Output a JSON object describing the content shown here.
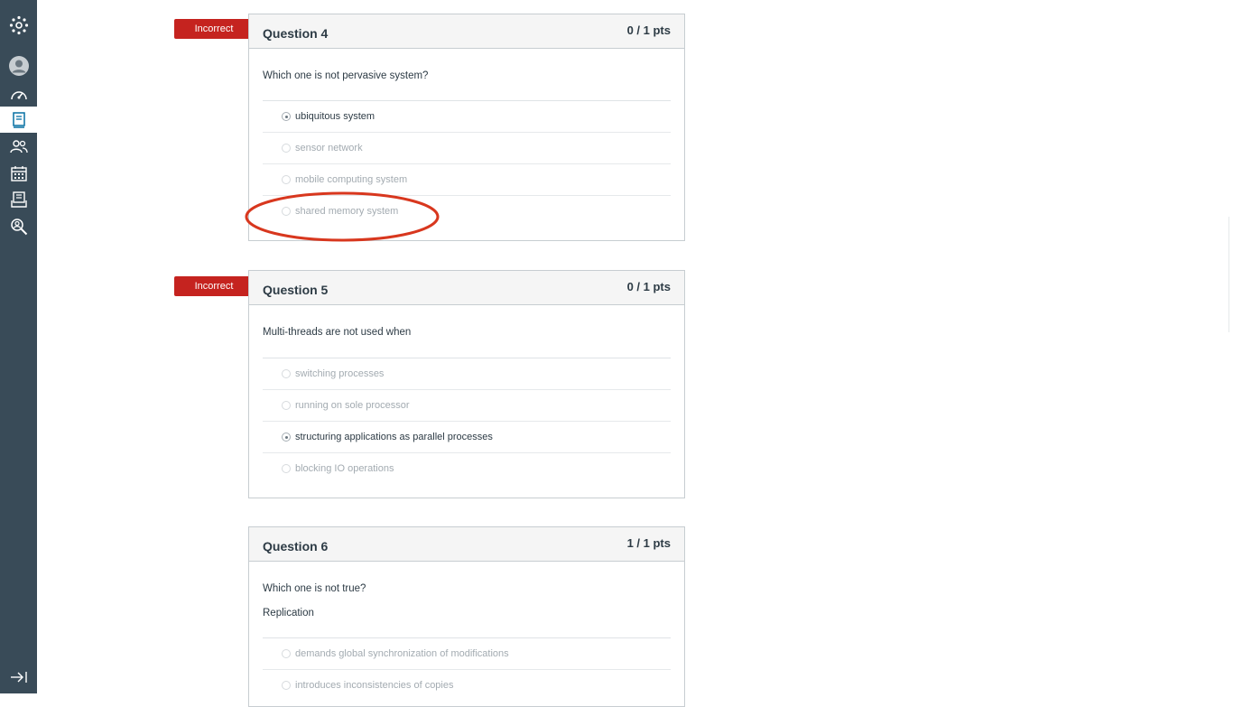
{
  "nav": {
    "items": [
      {
        "name": "logo",
        "icon": "canvas-logo-icon"
      },
      {
        "name": "account",
        "icon": "account-icon"
      },
      {
        "name": "dashboard",
        "icon": "dashboard-icon"
      },
      {
        "name": "courses",
        "icon": "courses-icon",
        "active": true
      },
      {
        "name": "groups",
        "icon": "groups-icon"
      },
      {
        "name": "calendar",
        "icon": "calendar-icon"
      },
      {
        "name": "inbox",
        "icon": "inbox-icon"
      },
      {
        "name": "help",
        "icon": "help-icon"
      },
      {
        "name": "collapse",
        "icon": "collapse-nav-icon"
      }
    ]
  },
  "colors": {
    "nav_bg": "#394b58",
    "accent": "#0770a3",
    "incorrect_red": "#c5231f",
    "annotation_red": "#d8371e"
  },
  "questions": [
    {
      "status": "Incorrect",
      "title": "Question 4",
      "points": "0 / 1 pts",
      "text": [
        "Which one is not pervasive system?"
      ],
      "answers": [
        {
          "label": "ubiquitous system",
          "selected": true
        },
        {
          "label": "sensor network",
          "selected": false
        },
        {
          "label": "mobile computing system",
          "selected": false
        },
        {
          "label": "shared memory system",
          "selected": false
        }
      ]
    },
    {
      "status": "Incorrect",
      "title": "Question 5",
      "points": "0 / 1 pts",
      "text": [
        "Multi-threads are not used when"
      ],
      "answers": [
        {
          "label": "switching processes",
          "selected": false
        },
        {
          "label": "running on sole processor",
          "selected": false
        },
        {
          "label": "structuring applications as parallel processes",
          "selected": true
        },
        {
          "label": "blocking IO operations",
          "selected": false
        }
      ]
    },
    {
      "status": "",
      "title": "Question 6",
      "points": "1 / 1 pts",
      "text": [
        "Which one is not true?",
        "Replication"
      ],
      "answers": [
        {
          "label": "demands global synchronization of modifications",
          "selected": false
        },
        {
          "label": "introduces inconsistencies of copies",
          "selected": false
        }
      ]
    }
  ]
}
